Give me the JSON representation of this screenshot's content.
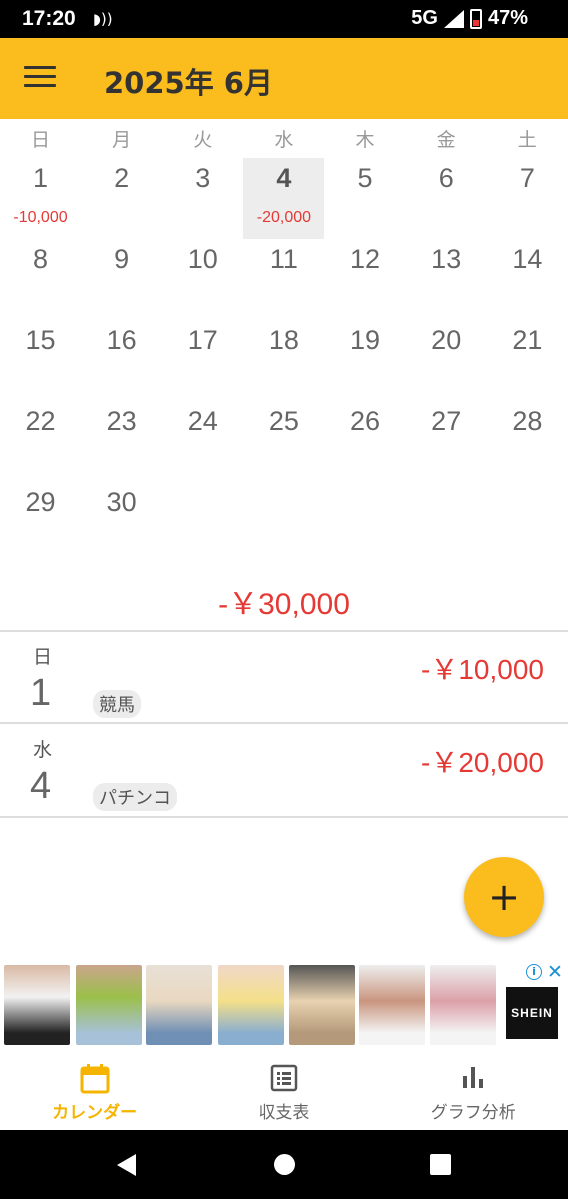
{
  "status_bar": {
    "time": "17:20",
    "network": "5G",
    "battery": "47%"
  },
  "app_bar": {
    "title": "2025年 6月"
  },
  "calendar": {
    "weekdays": [
      "日",
      "月",
      "火",
      "水",
      "木",
      "金",
      "土"
    ],
    "days": [
      {
        "day": "1",
        "amount": "-10,000"
      },
      {
        "day": "2"
      },
      {
        "day": "3"
      },
      {
        "day": "4",
        "amount": "-20,000",
        "selected": true
      },
      {
        "day": "5"
      },
      {
        "day": "6"
      },
      {
        "day": "7"
      },
      {
        "day": "8"
      },
      {
        "day": "9"
      },
      {
        "day": "10"
      },
      {
        "day": "11"
      },
      {
        "day": "12"
      },
      {
        "day": "13"
      },
      {
        "day": "14"
      },
      {
        "day": "15"
      },
      {
        "day": "16"
      },
      {
        "day": "17"
      },
      {
        "day": "18"
      },
      {
        "day": "19"
      },
      {
        "day": "20"
      },
      {
        "day": "21"
      },
      {
        "day": "22"
      },
      {
        "day": "23"
      },
      {
        "day": "24"
      },
      {
        "day": "25"
      },
      {
        "day": "26"
      },
      {
        "day": "27"
      },
      {
        "day": "28"
      },
      {
        "day": "29"
      },
      {
        "day": "30"
      }
    ],
    "first_weekday_index": 0,
    "month_total": "-￥30,000"
  },
  "entries": [
    {
      "weekday": "日",
      "day": "1",
      "category": "競馬",
      "amount": "-￥10,000"
    },
    {
      "weekday": "水",
      "day": "4",
      "category": "パチンコ",
      "amount": "-￥20,000"
    }
  ],
  "fab": {
    "icon": "plus-icon",
    "label": "+"
  },
  "ad": {
    "brand": "SHEIN",
    "info_icon": "i",
    "close_icon": "✕"
  },
  "bottom_nav": [
    {
      "label": "カレンダー",
      "icon": "calendar-icon",
      "active": true
    },
    {
      "label": "収支表",
      "icon": "list-icon",
      "active": false
    },
    {
      "label": "グラフ分析",
      "icon": "bar-chart-icon",
      "active": false
    }
  ],
  "colors": {
    "accent": "#fbbd1e",
    "negative": "#e53935",
    "active_nav": "#f4b400"
  }
}
